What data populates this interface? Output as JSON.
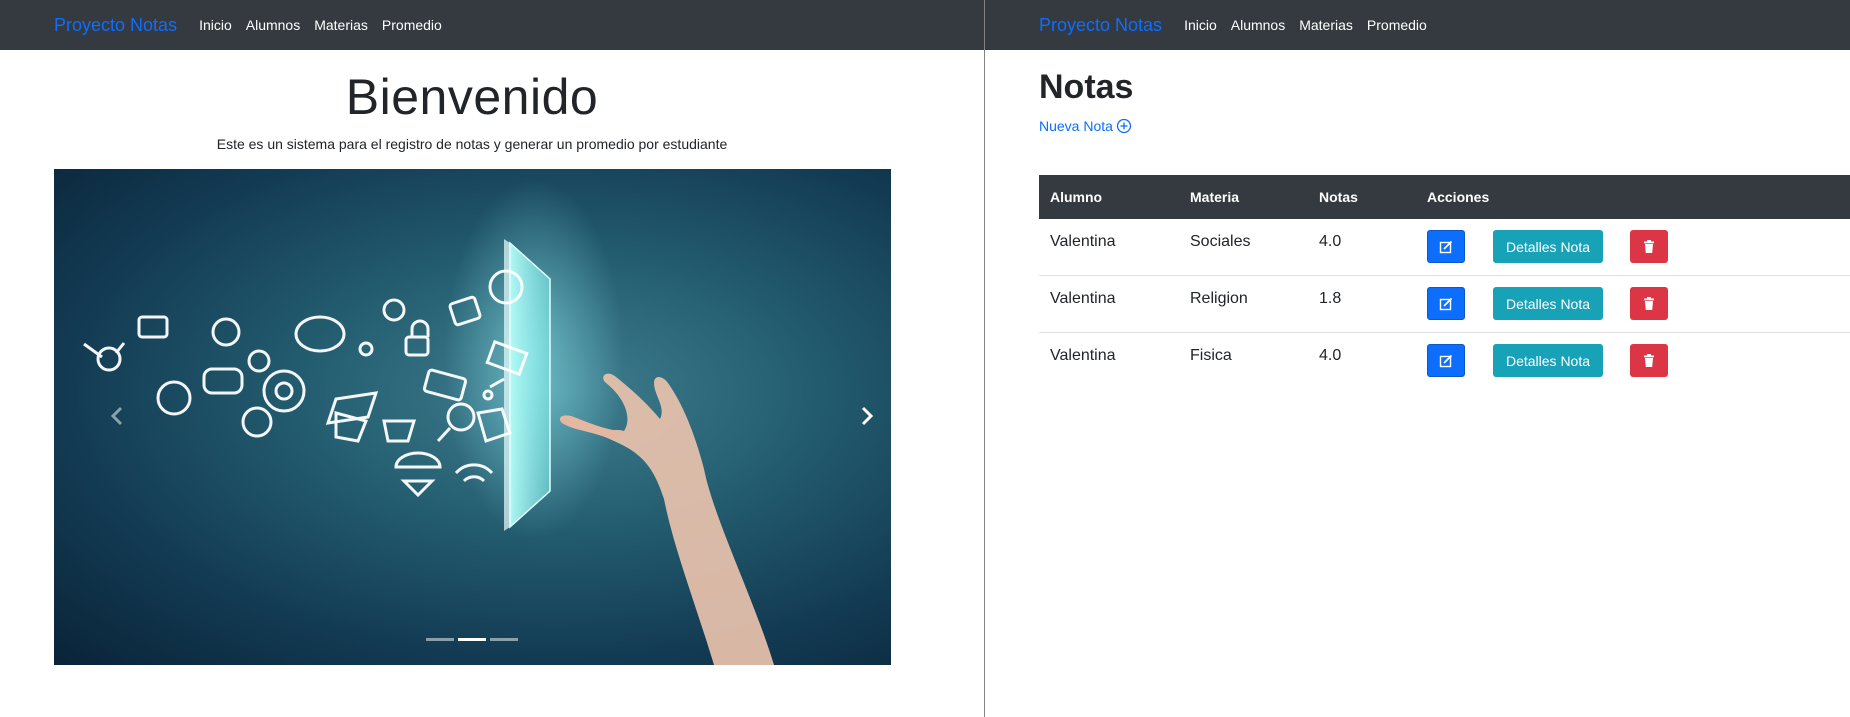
{
  "left": {
    "navbar": {
      "brand": "Proyecto Notas",
      "links": [
        "Inicio",
        "Alumnos",
        "Materias",
        "Promedio"
      ]
    },
    "hero": {
      "title": "Bienvenido",
      "subtitle": "Este es un sistema para el registro de notas y generar un promedio por estudiante"
    },
    "carousel": {
      "indicator_count": 3,
      "active_indicator": 2,
      "prev_icon": "chevron-left-icon",
      "next_icon": "chevron-right-icon"
    }
  },
  "right": {
    "navbar": {
      "brand": "Proyecto Notas",
      "links": [
        "Inicio",
        "Alumnos",
        "Materias",
        "Promedio"
      ]
    },
    "title": "Notas",
    "new_link": "Nueva Nota",
    "table": {
      "headers": [
        "Alumno",
        "Materia",
        "Notas",
        "Acciones"
      ],
      "rows": [
        {
          "alumno": "Valentina",
          "materia": "Sociales",
          "nota": "4.0"
        },
        {
          "alumno": "Valentina",
          "materia": "Religion",
          "nota": "1.8"
        },
        {
          "alumno": "Valentina",
          "materia": "Fisica",
          "nota": "4.0"
        }
      ],
      "details_label": "Detalles Nota"
    }
  },
  "colors": {
    "navbar": "#343a40",
    "brand": "#0d6efd",
    "primary": "#0d6efd",
    "info": "#17a2b8",
    "danger": "#dc3545"
  }
}
